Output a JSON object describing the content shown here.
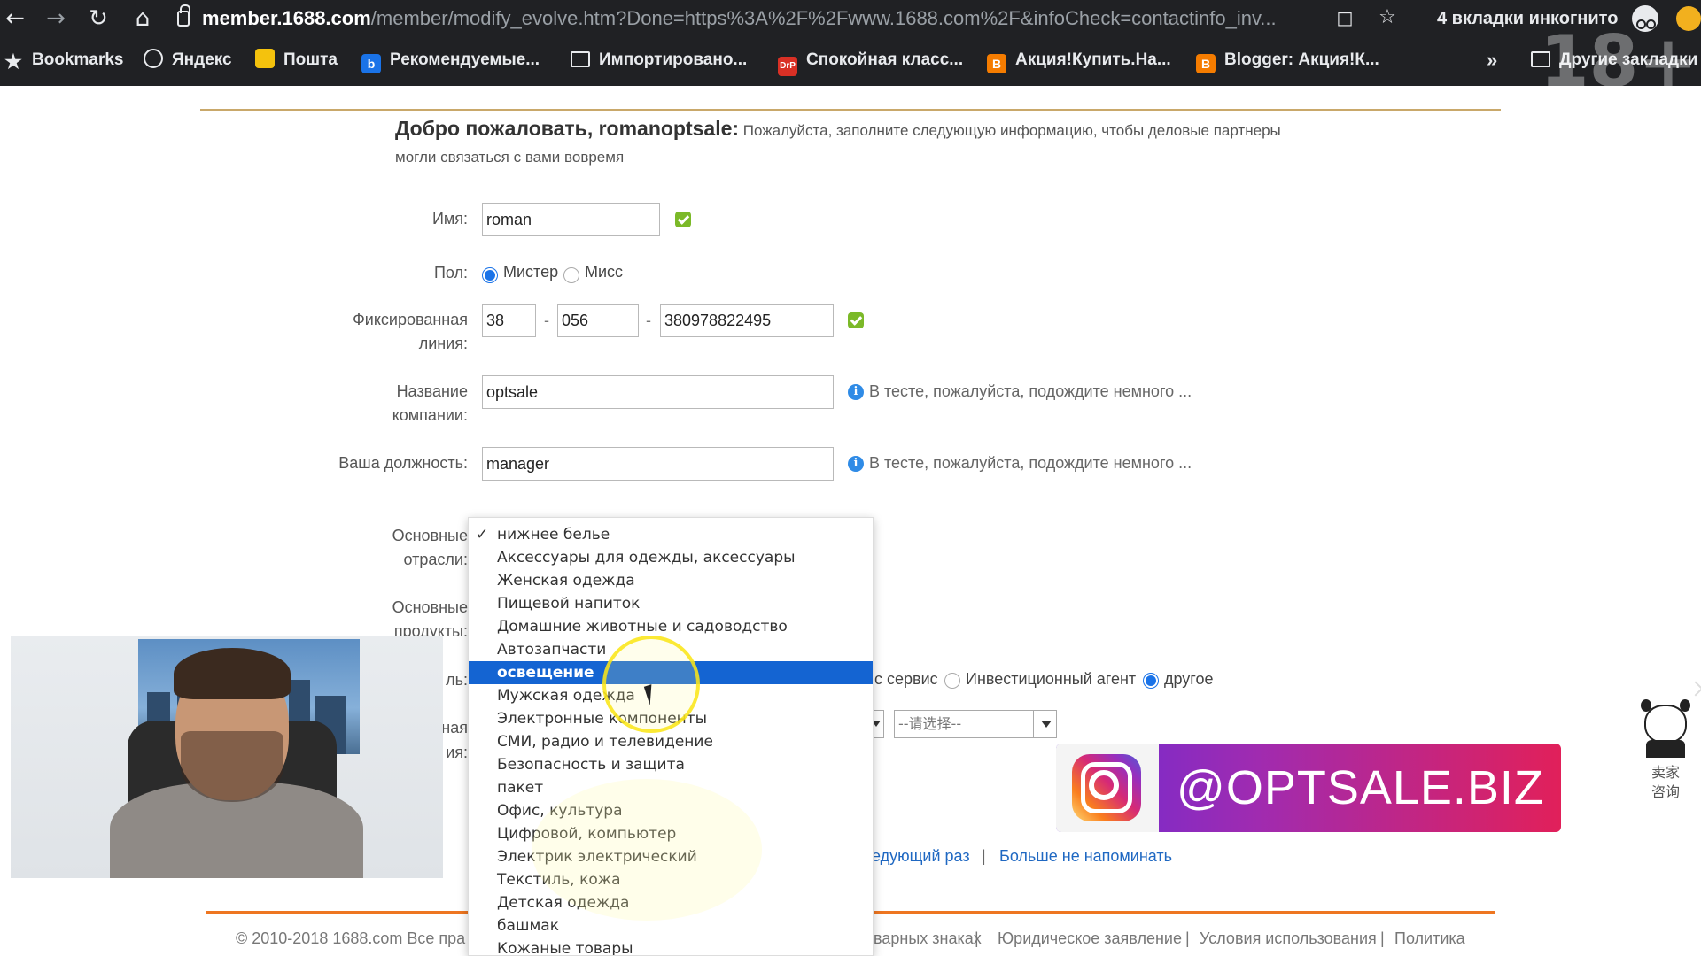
{
  "browser": {
    "url_host": "member.1688.com",
    "url_path": "/member/modify_evolve.htm?Done=https%3A%2F%2Fwww.1688.com%2F&infoCheck=contactinfo_inv...",
    "incognito_label": "4 вкладки инкогнито",
    "watermark": "18+",
    "bookmarks": [
      {
        "label": "Bookmarks",
        "icon": "star-icon"
      },
      {
        "label": "Яндекс",
        "icon": "globe-icon"
      },
      {
        "label": "Пошта",
        "icon": "mail-icon"
      },
      {
        "label": "Рекомендуемые...",
        "icon": "bing-icon"
      },
      {
        "label": "Импортировано...",
        "icon": "folder-icon"
      },
      {
        "label": "Спокойная класс...",
        "icon": "drp-icon"
      },
      {
        "label": "Акция!Купить.На...",
        "icon": "blogger-icon"
      },
      {
        "label": "Blogger: Акция!К...",
        "icon": "blogger-icon"
      },
      {
        "label": "Другие закладки",
        "icon": "folder-icon"
      }
    ]
  },
  "welcome": {
    "title": "Добро пожаловать, romanoptsale:",
    "text": " Пожалуйста, заполните следующую информацию, чтобы деловые партнеры могли связаться с вами вовремя"
  },
  "form": {
    "name": {
      "label": "Имя:",
      "value": "roman"
    },
    "gender": {
      "label": "Пол:",
      "options": [
        "Мистер",
        "Мисс"
      ],
      "selected": "Мистер"
    },
    "phone": {
      "label": "Фиксированная линия:",
      "country": "38",
      "area": "056",
      "number": "380978822495",
      "separator": "-"
    },
    "company": {
      "label": "Название компании:",
      "value": "optsale",
      "hint": "В тесте, пожалуйста, подождите немного ..."
    },
    "position": {
      "label": "Ваша должность:",
      "value": "manager",
      "hint": "В тесте, пожалуйста, подождите немного ..."
    },
    "industry": {
      "label": "Основные отрасли:"
    },
    "products": {
      "label": "Основные продукты:"
    },
    "model": {
      "label_fragment": "ль:",
      "options": [
        "с сервис",
        "Инвестиционный агент",
        "другое"
      ],
      "selected": "другое"
    },
    "region": {
      "label_fragment": "ная ия:",
      "select_placeholder": "--请选择--"
    }
  },
  "dropdown": {
    "selected": "освещение",
    "checked": "нижнее белье",
    "items": [
      "нижнее белье",
      "Аксессуары для одежды, аксессуары",
      "Женская одежда",
      "Пищевой напиток",
      "Домашние животные и садоводство",
      "Автозапчасти",
      "освещение",
      "Мужская одежда",
      "Электронные компоненты",
      "СМИ, радио и телевидение",
      "Безопасность и защита",
      "пакет",
      "Офис, культура",
      "Цифровой, компьютер",
      "Электрик электрический",
      "Текстиль, кожа",
      "Детская одежда",
      "башмак",
      "Кожаные товары"
    ]
  },
  "reminder": {
    "later": "едующий раз",
    "separator": "|",
    "never": "Больше не напоминать"
  },
  "footer": {
    "copyright": "© 2010-2018 1688.com Все пра",
    "links": [
      "варных знаках",
      "Юридическое заявление",
      "Условия использования",
      "Политика"
    ],
    "separator": "|"
  },
  "overlay": {
    "instagram_handle": "@OPTSALE.BIZ",
    "mascot_text": "卖家咨询"
  },
  "colors": {
    "accent_blue": "#1464d2",
    "ok_green": "#7bb928",
    "info_blue": "#2f8be6",
    "footer_orange": "#ee7621",
    "header_gold": "#c9a86a",
    "link_blue": "#1f68c2"
  }
}
